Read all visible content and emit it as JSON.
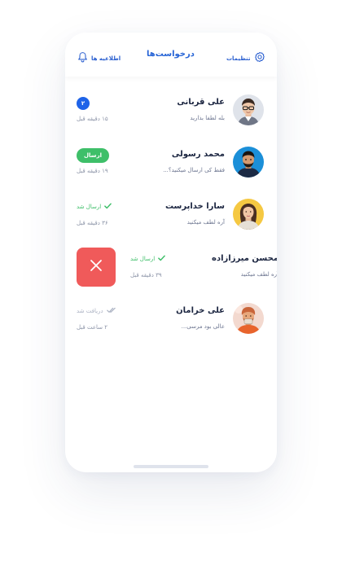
{
  "header": {
    "settings_label": "تنظیمات",
    "title": "درخواست‌ها",
    "notifications_label": "اطلاعیه ها"
  },
  "requests": [
    {
      "name": "علی قربانی",
      "preview": "بله لطفا بذارید",
      "time": "۱۵ دقیقه قبل",
      "unread_count": "۲"
    },
    {
      "name": "محمد رسولی",
      "preview": "فقط کی ارسال میکنید؟...",
      "time": "۱۹ دقیقه قبل",
      "action_label": "ارسال"
    },
    {
      "name": "سارا خداپرست",
      "preview": "آره لطف میکنید",
      "time": "۳۶ دقیقه قبل",
      "status": "ارسال شد"
    },
    {
      "name": "محسن میرزازاده",
      "preview": "آره لطف میکنید",
      "time": "۳۹ دقیقه قبل",
      "status": "ارسال شد"
    },
    {
      "name": "علی خرامان",
      "preview": "عالی بود مرسی...",
      "time": "۲ ساعت قبل",
      "status": "دریافت شد"
    }
  ],
  "colors": {
    "accent": "#2563d6",
    "badge": "#1e63e8",
    "success": "#3ebf69",
    "danger": "#f05a5a",
    "muted": "#aab1c2"
  },
  "icons": {
    "settings": "gear-icon",
    "notifications": "bell-icon",
    "sent": "check-icon",
    "received": "double-check-icon",
    "delete": "close-icon"
  }
}
